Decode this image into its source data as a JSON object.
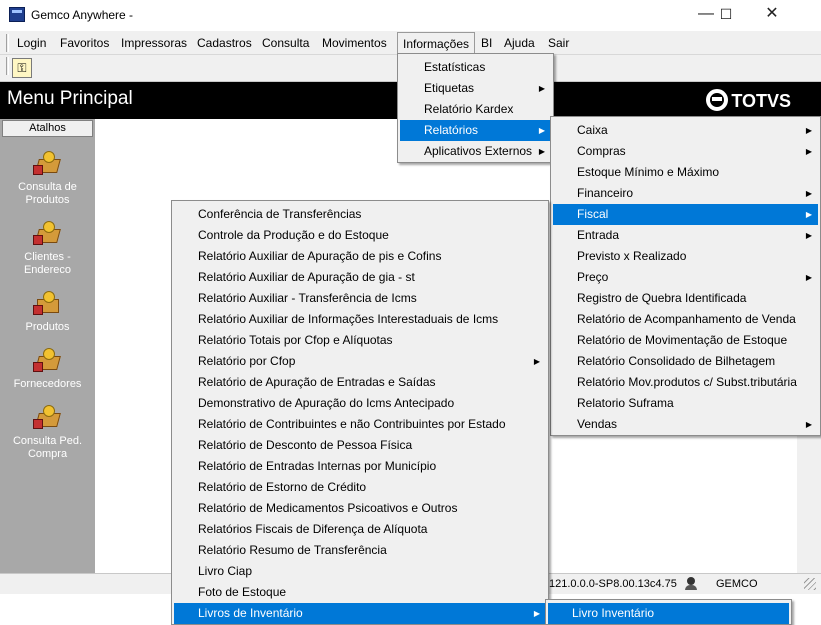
{
  "window": {
    "title": "Gemco Anywhere -",
    "minimize": "—",
    "maximize": "☐",
    "close": "✕"
  },
  "menubar": [
    "Login",
    "Favoritos",
    "Impressoras",
    "Cadastros",
    "Consulta",
    "Movimentos",
    "Informações",
    "BI",
    "Ajuda",
    "Sair"
  ],
  "toolbar": {
    "icon": "key-icon"
  },
  "header": {
    "title": "Menu Principal",
    "brand": "TOTVS"
  },
  "sidebar": {
    "heading": "Atalhos",
    "items": [
      {
        "label": "Consulta de Produtos",
        "icon": "products-icon"
      },
      {
        "label": "Clientes - Endereco",
        "icon": "clients-icon"
      },
      {
        "label": "Produtos",
        "icon": "box-icon"
      },
      {
        "label": "Fornecedores",
        "icon": "supplier-icon"
      },
      {
        "label": "Consulta Ped. Compra",
        "icon": "order-icon"
      }
    ]
  },
  "status": {
    "version": "121.0.0.0-SP8.00.13c4.75",
    "user": "GEMCO"
  },
  "menu_informacoes": [
    {
      "label": "Estatísticas",
      "submenu": false,
      "selected": false
    },
    {
      "label": "Etiquetas",
      "submenu": true,
      "selected": false
    },
    {
      "label": "Relatório Kardex",
      "submenu": false,
      "selected": false
    },
    {
      "label": "Relatórios",
      "submenu": true,
      "selected": true
    },
    {
      "label": "Aplicativos Externos",
      "submenu": true,
      "selected": false
    }
  ],
  "menu_relatorios": [
    {
      "label": "Caixa",
      "submenu": true,
      "selected": false
    },
    {
      "label": "Compras",
      "submenu": true,
      "selected": false
    },
    {
      "label": "Estoque Mínimo e Máximo",
      "submenu": false,
      "selected": false
    },
    {
      "label": "Financeiro",
      "submenu": true,
      "selected": false
    },
    {
      "label": "Fiscal",
      "submenu": true,
      "selected": true
    },
    {
      "label": "Entrada",
      "submenu": true,
      "selected": false
    },
    {
      "label": "Previsto x Realizado",
      "submenu": false,
      "selected": false
    },
    {
      "label": "Preço",
      "submenu": true,
      "selected": false
    },
    {
      "label": "Registro de Quebra Identificada",
      "submenu": false,
      "selected": false
    },
    {
      "label": "Relatório de Acompanhamento de Venda",
      "submenu": false,
      "selected": false
    },
    {
      "label": "Relatório de Movimentação de Estoque",
      "submenu": false,
      "selected": false
    },
    {
      "label": "Relatório Consolidado de Bilhetagem",
      "submenu": false,
      "selected": false
    },
    {
      "label": "Relatório Mov.produtos c/ Subst.tributária",
      "submenu": false,
      "selected": false
    },
    {
      "label": "Relatorio Suframa",
      "submenu": false,
      "selected": false
    },
    {
      "label": "Vendas",
      "submenu": true,
      "selected": false
    }
  ],
  "menu_fiscal": [
    {
      "label": "Conferência de Transferências",
      "submenu": false,
      "selected": false
    },
    {
      "label": "Controle da Produção e do Estoque",
      "submenu": false,
      "selected": false
    },
    {
      "label": "Relatório Auxiliar de Apuração de pis e Cofins",
      "submenu": false,
      "selected": false
    },
    {
      "label": "Relatório Auxiliar de Apuração de  gia -  st",
      "submenu": false,
      "selected": false
    },
    {
      "label": "Relatório Auxiliar - Transferência de Icms",
      "submenu": false,
      "selected": false
    },
    {
      "label": "Relatório Auxiliar de Informações Interestaduais de Icms",
      "submenu": false,
      "selected": false
    },
    {
      "label": "Relatório Totais por Cfop e Alíquotas",
      "submenu": false,
      "selected": false
    },
    {
      "label": "Relatório por Cfop",
      "submenu": true,
      "selected": false
    },
    {
      "label": "Relatório de Apuração de Entradas e Saídas",
      "submenu": false,
      "selected": false
    },
    {
      "label": "Demonstrativo de Apuração do Icms Antecipado",
      "submenu": false,
      "selected": false
    },
    {
      "label": "Relatório de Contribuintes e não Contribuintes por Estado",
      "submenu": false,
      "selected": false
    },
    {
      "label": "Relatório de Desconto de Pessoa Física",
      "submenu": false,
      "selected": false
    },
    {
      "label": "Relatório de Entradas Internas por Município",
      "submenu": false,
      "selected": false
    },
    {
      "label": "Relatório de Estorno de Crédito",
      "submenu": false,
      "selected": false
    },
    {
      "label": "Relatório de Medicamentos Psicoativos e Outros",
      "submenu": false,
      "selected": false
    },
    {
      "label": "Relatórios Fiscais de Diferença de Alíquota",
      "submenu": false,
      "selected": false
    },
    {
      "label": "Relatório Resumo de Transferência",
      "submenu": false,
      "selected": false
    },
    {
      "label": "Livro Ciap",
      "submenu": false,
      "selected": false
    },
    {
      "label": "Foto de Estoque",
      "submenu": false,
      "selected": false
    },
    {
      "label": "Livros de Inventário",
      "submenu": true,
      "selected": true
    }
  ],
  "menu_livros": [
    {
      "label": "Livro Inventário",
      "submenu": false,
      "selected": true
    }
  ]
}
